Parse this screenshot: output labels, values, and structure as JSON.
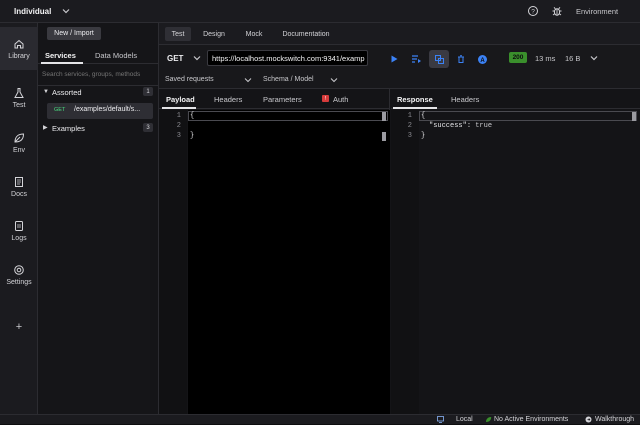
{
  "topbar": {
    "workspace": "Individual",
    "environment_label": "Environment"
  },
  "rail": {
    "items": [
      {
        "label": "Library",
        "icon": "home-icon"
      },
      {
        "label": "Test",
        "icon": "flask-icon"
      },
      {
        "label": "Env",
        "icon": "leaf-icon"
      },
      {
        "label": "Docs",
        "icon": "document-icon"
      },
      {
        "label": "Logs",
        "icon": "logs-icon"
      },
      {
        "label": "Settings",
        "icon": "gear-icon"
      }
    ],
    "add_label": "+"
  },
  "library": {
    "new_import_label": "New / Import",
    "tabs": [
      "Services",
      "Data Models"
    ],
    "search_placeholder": "Search services, groups, methods",
    "groups": [
      {
        "name": "Assorted",
        "count": "1",
        "expanded": true
      },
      {
        "name": "Examples",
        "count": "3",
        "expanded": false
      }
    ],
    "endpoint": {
      "method": "GET",
      "path": "/examples/default/s..."
    }
  },
  "main": {
    "tabs": [
      "Test",
      "Design",
      "Mock",
      "Documentation"
    ],
    "method": "GET",
    "url": "https://localhost.mockswitch.com:9341/examp",
    "status_code": "200",
    "time": "13 ms",
    "size": "16 B",
    "saved_requests_label": "Saved requests",
    "schema_label": "Schema / Model",
    "request_tabs": [
      "Payload",
      "Headers",
      "Parameters",
      "Auth"
    ],
    "response_tabs": [
      "Response",
      "Headers"
    ],
    "request_lines": [
      {
        "n": "1",
        "text": "{"
      },
      {
        "n": "2",
        "text": ""
      },
      {
        "n": "3",
        "text": "}"
      }
    ],
    "response_lines": [
      {
        "n": "1",
        "text": "{"
      },
      {
        "n": "2",
        "key": "\"success\"",
        "sep": ": ",
        "value": "true"
      },
      {
        "n": "3",
        "text": "}"
      }
    ]
  },
  "statusbar": {
    "local": "Local",
    "environments": "No Active Environments",
    "walkthrough": "Walkthrough"
  },
  "colors": {
    "accent_green": "#3a8f2c",
    "accent_blue": "#3b82f6",
    "auth_badge": "#d63b3b"
  }
}
